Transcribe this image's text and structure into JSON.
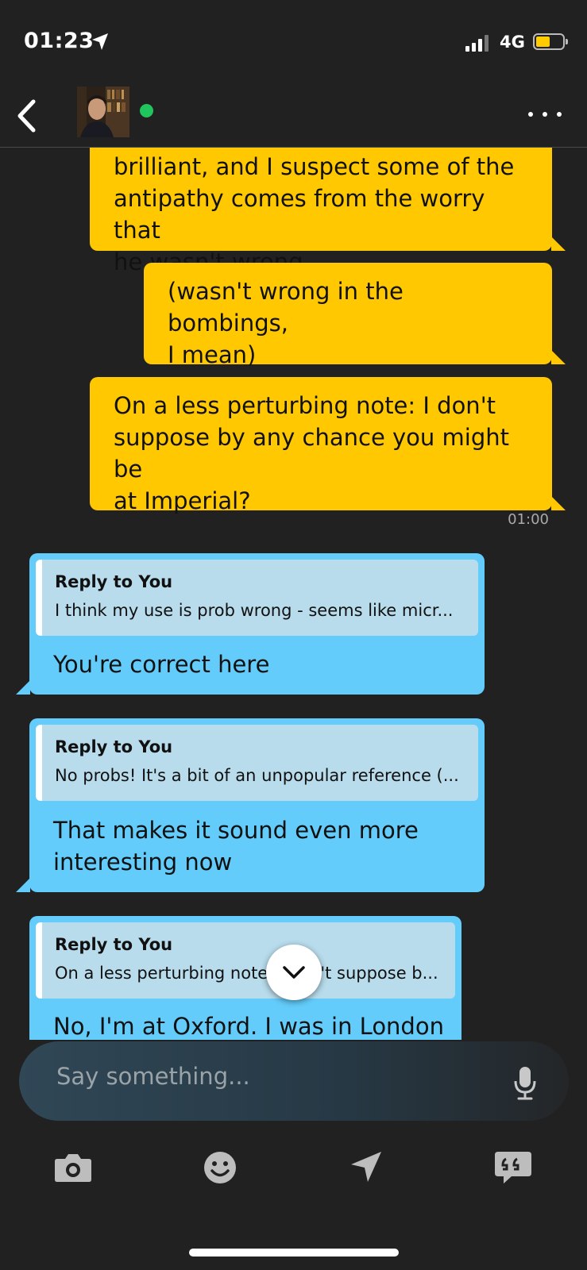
{
  "status_bar": {
    "time": "01:23",
    "network": "4G",
    "location_icon": "location-arrow-icon",
    "battery_color": "#ffcc00"
  },
  "header": {
    "back_icon": "chevron-left-icon",
    "online_color": "#21c55d",
    "more_icon": "ellipsis-icon"
  },
  "messages": {
    "out": [
      {
        "text_lines": [
          "brilliant, and I suspect some of the",
          "antipathy comes from the worry that",
          "he wasn't wrong"
        ]
      },
      {
        "text_lines": [
          "(wasn't wrong in the bombings,",
          "I mean)"
        ]
      },
      {
        "text_lines": [
          "On a less perturbing note: I don't",
          "suppose by any chance you might be",
          "at Imperial?"
        ]
      }
    ],
    "out_timestamp": "01:00",
    "in": [
      {
        "reply_title": "Reply to You",
        "reply_text": "I think my use is prob wrong - seems like micr...",
        "text_lines": [
          "You're correct here"
        ]
      },
      {
        "reply_title": "Reply to You",
        "reply_text": "No probs! It's a bit of an unpopular reference (...",
        "text_lines": [
          "That makes it sound even more",
          "interesting now"
        ]
      },
      {
        "reply_title": "Reply to You",
        "reply_text": "On a less perturbing note: I don't suppose b...",
        "text_lines": [
          "No, I'm at Oxford. I was in London"
        ]
      }
    ],
    "colors": {
      "outgoing": "#ffc800",
      "incoming": "#63ccfa",
      "quote": "#b8dcec"
    }
  },
  "composer": {
    "placeholder": "Say something...",
    "mic_icon": "microphone-icon"
  },
  "toolbar": {
    "items": [
      "camera-icon",
      "emoji-icon",
      "location-share-icon",
      "saved-phrases-icon"
    ]
  }
}
